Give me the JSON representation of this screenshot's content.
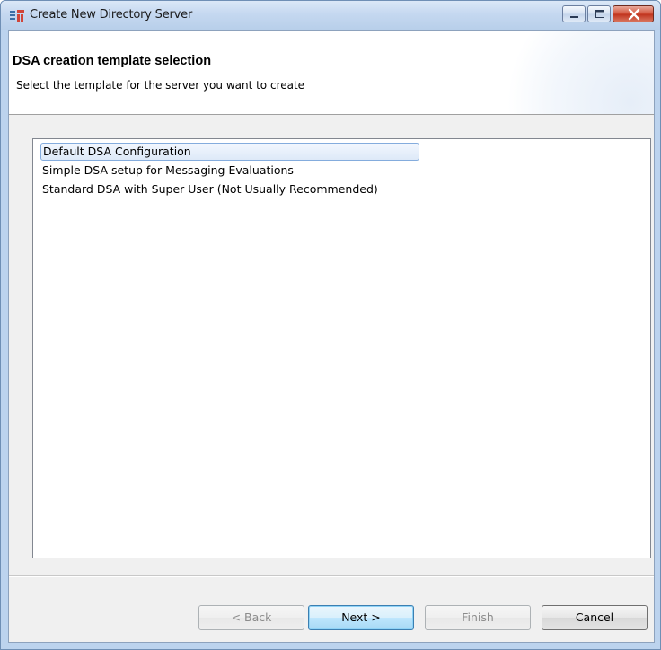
{
  "window": {
    "title": "Create New Directory Server",
    "icon": "window-app-icon",
    "controls": {
      "minimize": "minimize-icon",
      "maximize": "maximize-icon",
      "close": "close-icon"
    }
  },
  "header": {
    "title": "DSA creation template selection",
    "description": "Select the template for the server you want to create"
  },
  "templates": {
    "items": [
      {
        "label": "Default DSA Configuration",
        "selected": true
      },
      {
        "label": "Simple DSA setup for Messaging Evaluations",
        "selected": false
      },
      {
        "label": "Standard DSA with Super User (Not Usually Recommended)",
        "selected": false
      }
    ]
  },
  "buttons": {
    "back": {
      "label": "< Back",
      "enabled": false
    },
    "next": {
      "label": "Next >",
      "enabled": true,
      "default": true
    },
    "finish": {
      "label": "Finish",
      "enabled": false
    },
    "cancel": {
      "label": "Cancel",
      "enabled": true
    }
  },
  "colors": {
    "selection_border": "#84acdd",
    "selection_fill": "#dde9f8",
    "default_button": "#bee6fd",
    "close_button": "#c0311b"
  }
}
